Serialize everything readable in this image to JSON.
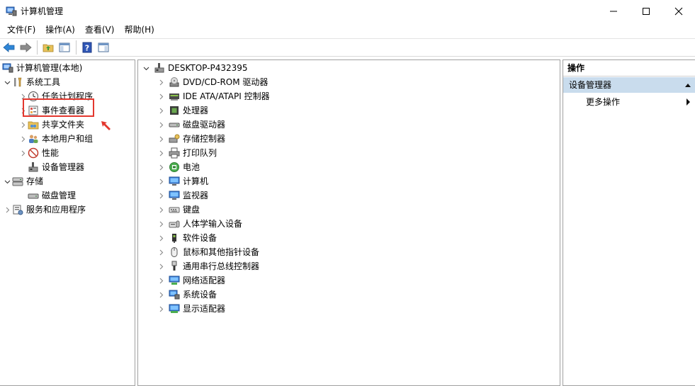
{
  "window": {
    "title": "计算机管理",
    "icon": "computer-management-icon",
    "buttons": [
      "minimize-icon",
      "maximize-icon",
      "close-icon"
    ]
  },
  "menu": [
    "文件(F)",
    "操作(A)",
    "查看(V)",
    "帮助(H)"
  ],
  "toolbar": {
    "buttons": [
      "back-arrow-icon",
      "forward-arrow-icon",
      "up-folder-icon",
      "show-hide-tree-icon",
      "help-icon",
      "show-hide-action-pane-icon"
    ]
  },
  "tree": {
    "root": "计算机管理(本地)",
    "system_tools": "系统工具",
    "task_scheduler": "任务计划程序",
    "event_viewer": "事件查看器",
    "shared_folders": "共享文件夹",
    "local_users": "本地用户和组",
    "performance": "性能",
    "device_manager": "设备管理器",
    "storage": "存储",
    "disk_management": "磁盘管理",
    "services_apps": "服务和应用程序"
  },
  "devices": {
    "computer_name": "DESKTOP-P432395",
    "items": [
      {
        "label": "DVD/CD-ROM 驱动器",
        "icon": "dvd-drive-icon"
      },
      {
        "label": "IDE ATA/ATAPI 控制器",
        "icon": "ide-controller-icon"
      },
      {
        "label": "处理器",
        "icon": "processor-icon"
      },
      {
        "label": "磁盘驱动器",
        "icon": "disk-drive-icon"
      },
      {
        "label": "存储控制器",
        "icon": "storage-controller-icon"
      },
      {
        "label": "打印队列",
        "icon": "printer-icon"
      },
      {
        "label": "电池",
        "icon": "battery-icon"
      },
      {
        "label": "计算机",
        "icon": "computer-icon"
      },
      {
        "label": "监视器",
        "icon": "monitor-icon"
      },
      {
        "label": "键盘",
        "icon": "keyboard-icon"
      },
      {
        "label": "人体学输入设备",
        "icon": "hid-icon"
      },
      {
        "label": "软件设备",
        "icon": "software-device-icon"
      },
      {
        "label": "鼠标和其他指针设备",
        "icon": "mouse-icon"
      },
      {
        "label": "通用串行总线控制器",
        "icon": "usb-icon"
      },
      {
        "label": "网络适配器",
        "icon": "network-adapter-icon"
      },
      {
        "label": "系统设备",
        "icon": "system-device-icon"
      },
      {
        "label": "显示适配器",
        "icon": "display-adapter-icon"
      }
    ]
  },
  "actions": {
    "header": "操作",
    "section": "设备管理器",
    "more": "更多操作"
  },
  "colors": {
    "highlight_border": "#e3372e",
    "actions_section_bg": "#c9dced",
    "pane_border": "#a0a0a0"
  }
}
